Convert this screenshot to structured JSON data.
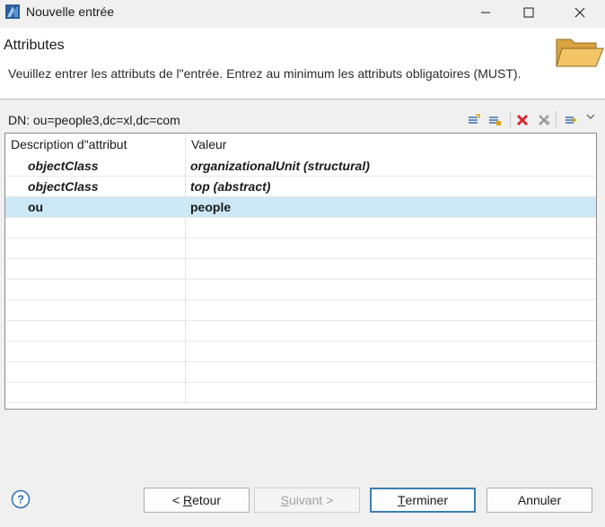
{
  "window": {
    "title": "Nouvelle entrée"
  },
  "banner": {
    "title": "Attributes",
    "description": "Veuillez entrer les attributs de l\"entrée. Entrez au minimum les attributs obligatoires (MUST)."
  },
  "dn": {
    "label": "DN: ou=people3,dc=xl,dc=com"
  },
  "toolbar": {
    "items": [
      "new-attribute-icon",
      "new-value-icon",
      "delete-icon",
      "delete-all-icon",
      "options-icon",
      "chevron-down-icon"
    ]
  },
  "table": {
    "columns": [
      "Description d\"attribut",
      "Valeur"
    ],
    "rows": [
      {
        "attribute": "objectClass",
        "value": "organizationalUnit (structural)",
        "italic": true,
        "selected": false
      },
      {
        "attribute": "objectClass",
        "value": "top (abstract)",
        "italic": true,
        "selected": false
      },
      {
        "attribute": "ou",
        "value": "people",
        "italic": false,
        "selected": true
      }
    ]
  },
  "buttons": {
    "back": {
      "prefix": "< ",
      "mnemonic": "R",
      "rest": "etour"
    },
    "next": {
      "mnemonic": "S",
      "rest": "uivant >"
    },
    "finish": {
      "mnemonic": "T",
      "rest": "erminer"
    },
    "cancel": "Annuler"
  },
  "colors": {
    "selection": "#cce8f6",
    "default_button_border": "#3c7fb1",
    "delete_red": "#d9282f"
  }
}
